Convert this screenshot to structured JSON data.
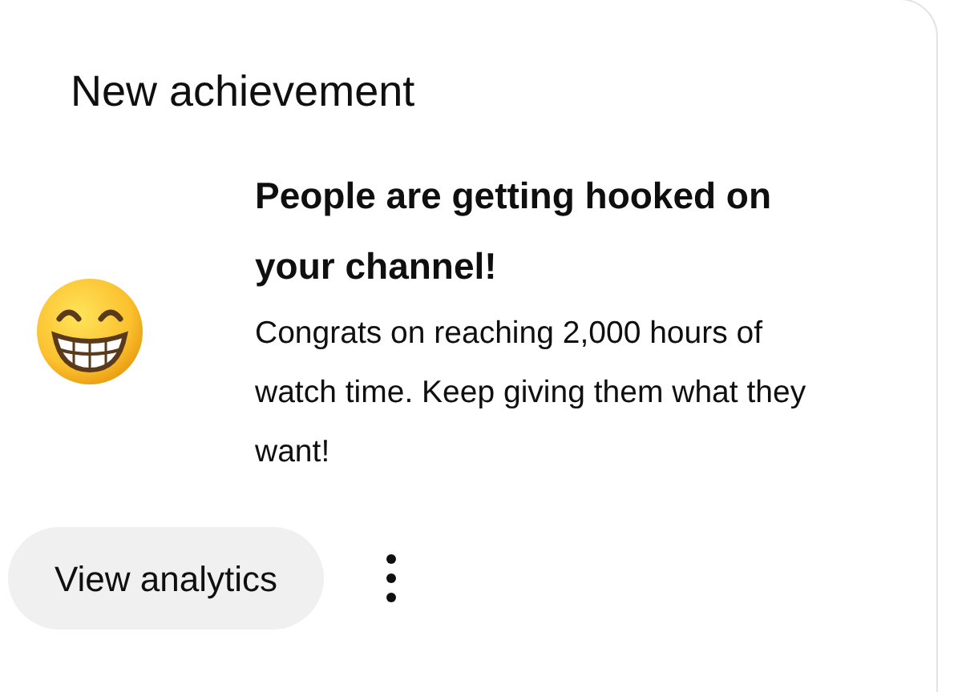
{
  "card": {
    "title": "New achievement",
    "achievement": {
      "heading": "People are getting hooked on your channel!",
      "body": "Congrats on reaching 2,000 hours of watch time. Keep giving them what they want!"
    },
    "button": {
      "label": "View analytics"
    }
  }
}
